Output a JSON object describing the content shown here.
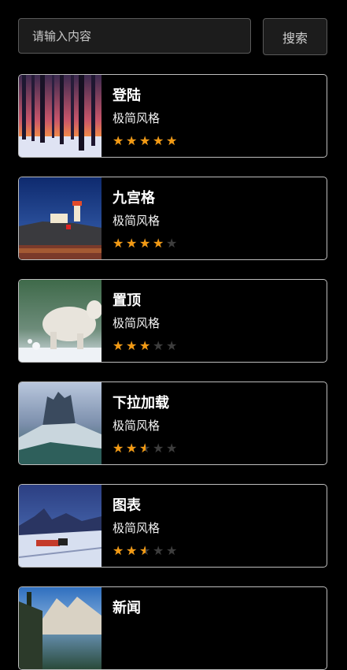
{
  "search": {
    "placeholder": "请输入内容",
    "button_label": "搜索"
  },
  "items": [
    {
      "title": "登陆",
      "subtitle": "极简风格",
      "rating": 5,
      "image": "winter-forest-sunset"
    },
    {
      "title": "九宫格",
      "subtitle": "极简风格",
      "rating": 4,
      "image": "lighthouse-night"
    },
    {
      "title": "置顶",
      "subtitle": "极简风格",
      "rating": 3,
      "image": "mountain-goat-snow"
    },
    {
      "title": "下拉加载",
      "subtitle": "极简风格",
      "rating": 2.5,
      "image": "dolomites-peaks"
    },
    {
      "title": "图表",
      "subtitle": "极简风格",
      "rating": 2.5,
      "image": "snowy-train-night"
    },
    {
      "title": "新闻",
      "subtitle": "",
      "rating": 0,
      "image": "alpine-lake-day"
    }
  ],
  "colors": {
    "star_filled": "#f29a14",
    "star_empty": "#3d3d3d",
    "card_border": "#bdbdbd"
  }
}
